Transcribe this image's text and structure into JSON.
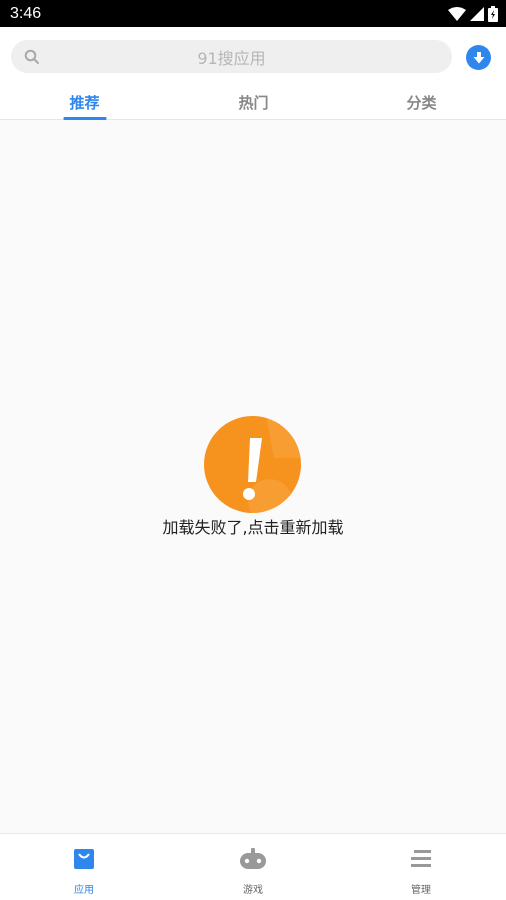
{
  "status_bar": {
    "time": "3:46"
  },
  "search": {
    "placeholder": "91搜应用",
    "value": ""
  },
  "tabs": [
    {
      "label": "推荐",
      "active": true
    },
    {
      "label": "热门",
      "active": false
    },
    {
      "label": "分类",
      "active": false
    }
  ],
  "content": {
    "error_message": "加载失败了,点击重新加载"
  },
  "bottom_nav": [
    {
      "label": "应用",
      "icon": "shopping-bag-icon",
      "active": true
    },
    {
      "label": "游戏",
      "icon": "gamepad-icon",
      "active": false
    },
    {
      "label": "管理",
      "icon": "menu-list-icon",
      "active": false
    }
  ],
  "colors": {
    "accent": "#2f86ec",
    "error_orange": "#f6921e",
    "status_bar": "#000000"
  }
}
